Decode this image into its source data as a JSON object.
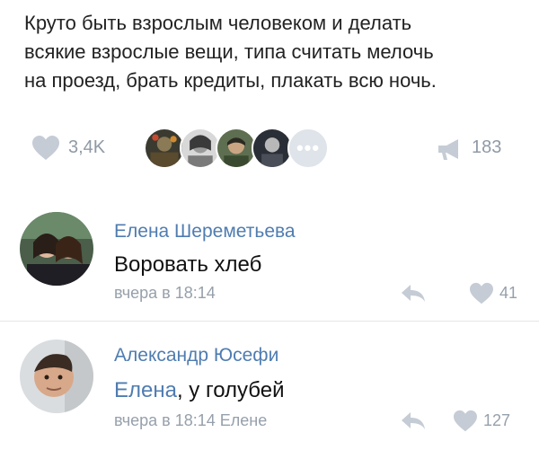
{
  "post": {
    "lines": [
      "Круто быть взрослым человеком и делать",
      "всякие взрослые вещи, типа считать мелочь",
      "на проезд, брать кредиты, плакать всю ночь."
    ]
  },
  "stats": {
    "likes": "3,4K",
    "more_label": "•••",
    "views": "183",
    "like_icon": "heart-icon",
    "views_icon": "megaphone-icon"
  },
  "comments": [
    {
      "author": "Елена Шереметьева",
      "text": "Воровать хлеб",
      "meta": "вчера в 18:14",
      "likes": "41"
    },
    {
      "author": "Александр Юсефи",
      "mention": "Елена",
      "text_rest": ", у голубей",
      "meta": "вчера в 18:14 Елене",
      "likes": "127"
    }
  ],
  "colors": {
    "link": "#4f7cb0",
    "muted": "#96a0ab",
    "icon": "#c5ccd5"
  }
}
